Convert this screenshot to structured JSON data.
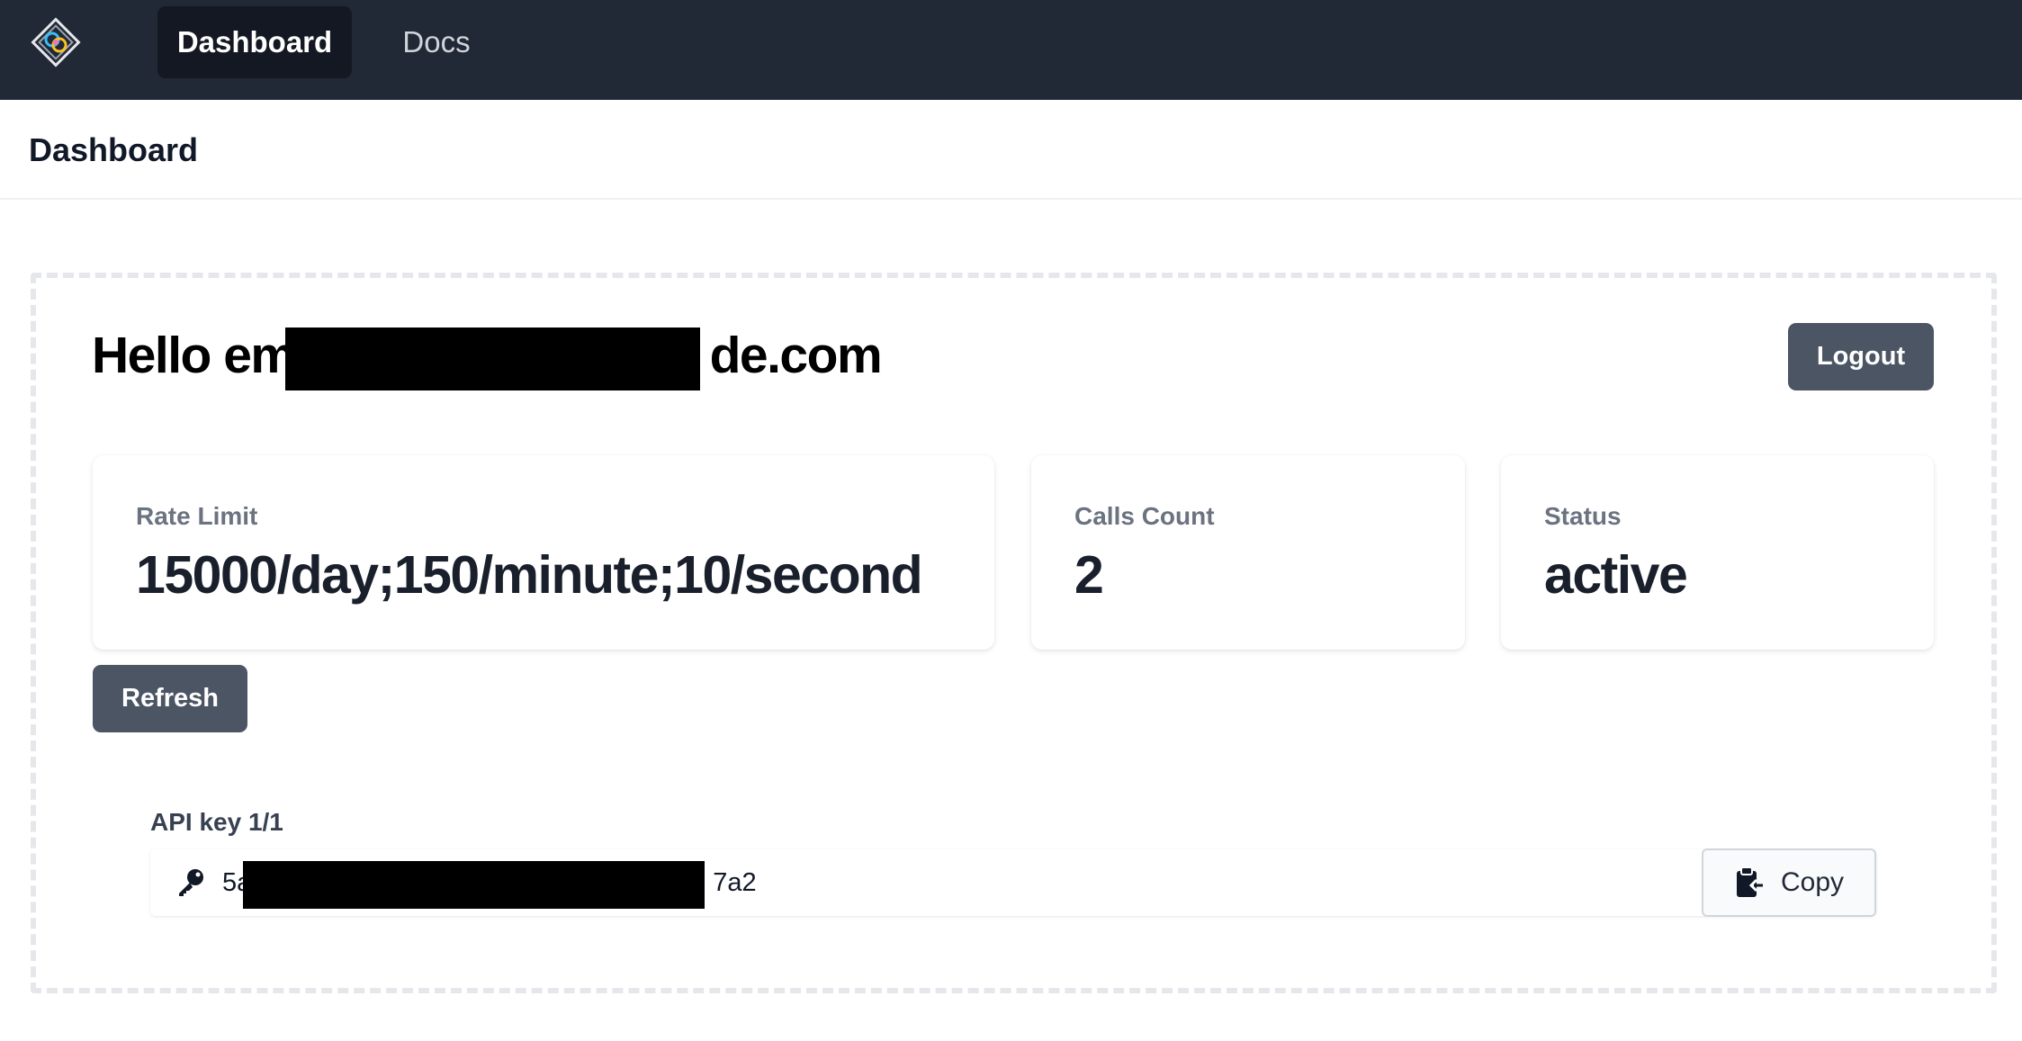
{
  "nav": {
    "logo": "logo",
    "tabs": [
      {
        "label": "Dashboard",
        "active": true
      },
      {
        "label": "Docs",
        "active": false
      }
    ],
    "background": "#212836",
    "active_tab_background": "#131822"
  },
  "header": {
    "title": "Dashboard"
  },
  "main": {
    "greeting": "Hello emde.com",
    "logout_label": "Logout",
    "refresh_label": "Refresh",
    "stats": [
      {
        "label": "Rate Limit",
        "value": "15000/day;150/minute;10/second"
      },
      {
        "label": "Calls Count",
        "value": "2"
      },
      {
        "label": "Status",
        "value": "active"
      }
    ],
    "api_key": {
      "label": "API key 1/1",
      "value": "5a7a2",
      "icon": "key-icon",
      "copy_label": "Copy",
      "copy_icon": "clipboard-icon"
    },
    "button_color": "#4b5563"
  }
}
